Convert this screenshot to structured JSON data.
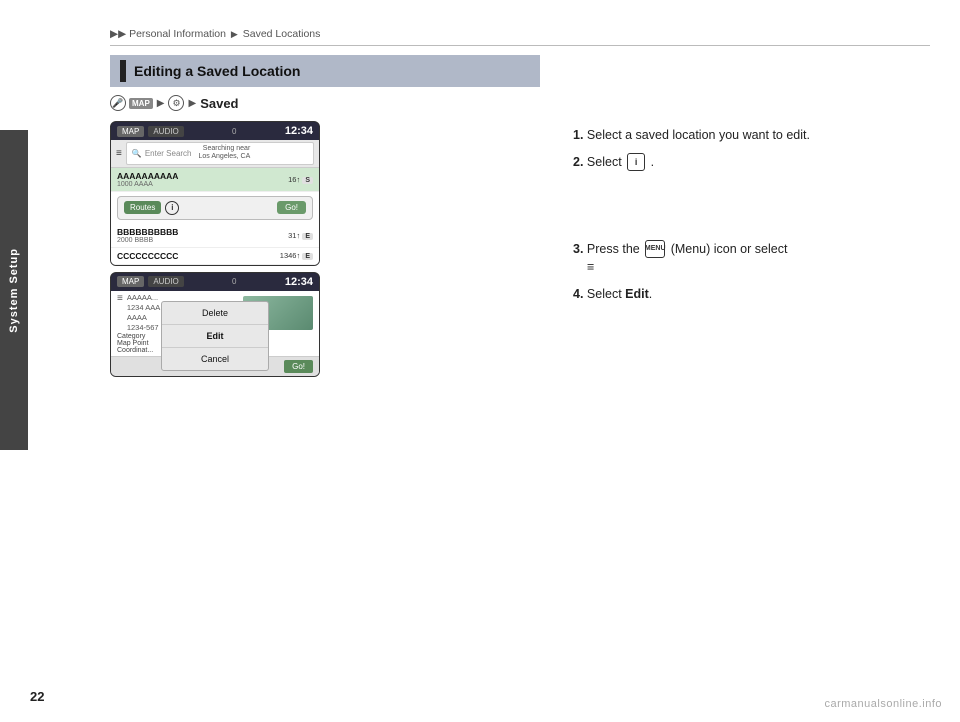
{
  "breadcrumb": {
    "arrows": "▶▶",
    "part1": "Personal Information",
    "arrow2": "▶",
    "part2": "Saved Locations"
  },
  "sidebar": {
    "label": "System Setup"
  },
  "section": {
    "title": "Editing a Saved Location"
  },
  "path": {
    "icon1": "🔍",
    "map_label": "MAP",
    "arrow": "▶",
    "camera_label": "⬤",
    "bold": "Saved"
  },
  "screen1": {
    "tab1": "MAP",
    "tab2": "AUDIO",
    "battery": "0",
    "time": "12:34",
    "search_placeholder": "Enter Search",
    "search_near_line1": "Searching near",
    "search_near_line2": "Los Angeles, CA",
    "items": [
      {
        "name": "AAAAAAAAAA",
        "sub": "1000 AAAA",
        "dist": "16↑",
        "badge": "S"
      },
      {
        "name": "BBBBBBBBBB",
        "sub": "2000 BBBB",
        "dist": "31↑",
        "badge": "E"
      },
      {
        "name": "CCCCCCCCCC",
        "sub": "",
        "dist": "1346↑",
        "badge": "E"
      }
    ],
    "routes_label": "Routes",
    "info_symbol": "i",
    "go_label": "Go!"
  },
  "screen2": {
    "tab1": "MAP",
    "tab2": "AUDIO",
    "battery": "0",
    "time": "12:34",
    "items": [
      {
        "text": "AAAAA..."
      },
      {
        "text": "1234 AAA"
      },
      {
        "text": "AAAA"
      },
      {
        "text": "1234-567"
      }
    ],
    "category_label": "Category",
    "mappoint_label": "Map Point",
    "coordinate_label": "Coordinat...",
    "context_menu": {
      "delete": "Delete",
      "edit": "Edit",
      "cancel": "Cancel"
    },
    "go_label": "Go!"
  },
  "instructions": {
    "step1_num": "1.",
    "step1_text": "Select a saved location you want to edit.",
    "step2_num": "2.",
    "step2_text": "Select",
    "step2_icon": "i",
    "step3_num": "3.",
    "step3_text": "Press the",
    "step3_icon": "MENU",
    "step3_text2": "(Menu) icon or select",
    "step3_symbol": "≡",
    "step4_num": "4.",
    "step4_text": "Select",
    "step4_bold": "Edit",
    "step4_period": "."
  },
  "page_number": "22",
  "watermark": "carmanualsonline.info"
}
